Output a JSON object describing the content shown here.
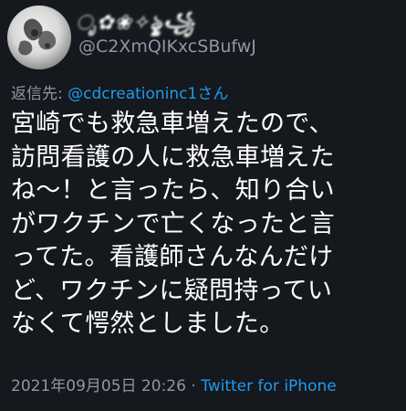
{
  "tweet": {
    "display_name": "ೃ✿❀✧ৡৢ꧁",
    "handle": "@C2XmQIKxcSBufwJ",
    "reply_label": "返信先: ",
    "reply_to": "@cdcreationinc1さん",
    "text_lines": [
      "宮崎でも救急車増えたので、",
      "訪問看護の人に救急車増えた",
      "ね〜！と言ったら、知り合い",
      "がワクチンで亡くなったと言",
      "ってた。看護師さんなんだけ",
      "ど、ワクチンに疑問持ってい",
      "なくて愕然としました。"
    ],
    "timestamp": "2021年09月05日 20:26",
    "separator": " · ",
    "source": "Twitter for iPhone"
  },
  "icons": {
    "avatar": "avatar-icon"
  },
  "colors": {
    "background": "#15181c",
    "text": "#ffffff",
    "muted": "#8b98a5",
    "link": "#1d9bf0"
  }
}
